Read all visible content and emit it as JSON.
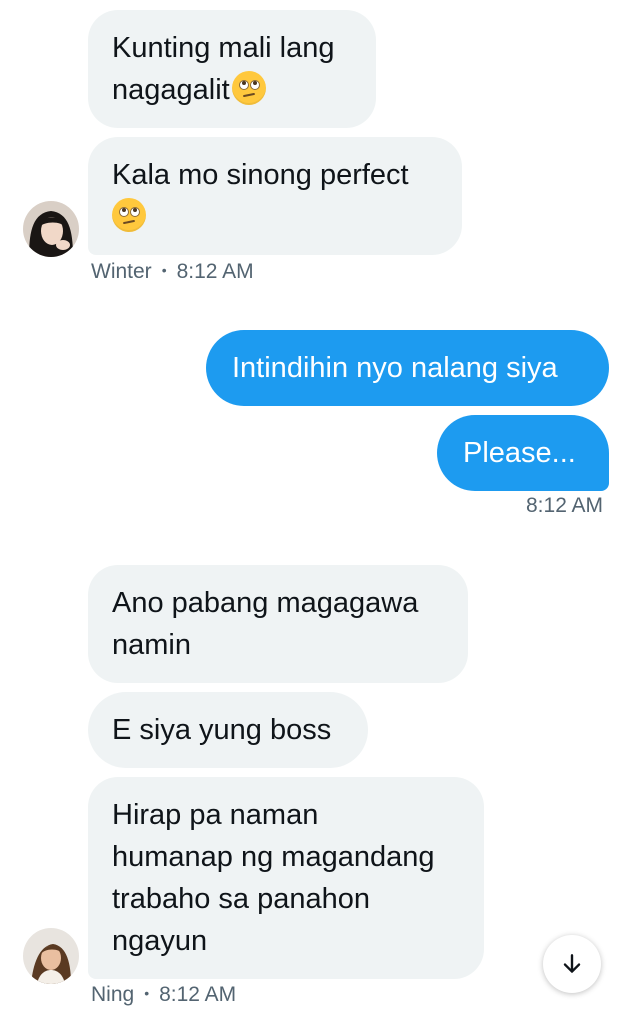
{
  "colors": {
    "incoming_bubble": "#eff3f4",
    "outgoing_bubble": "#1d9bf0",
    "meta_text": "#536471"
  },
  "messages": [
    {
      "group": "winter",
      "lines": [
        "Kunting mali lang",
        "nagagalit"
      ],
      "emoji": "face-with-rolling-eyes"
    },
    {
      "group": "winter",
      "lines": [
        "Kala mo sinong perfect"
      ],
      "emoji": "face-with-rolling-eyes"
    },
    {
      "group": "me",
      "lines": [
        "Intindihin nyo nalang siya"
      ]
    },
    {
      "group": "me",
      "lines": [
        "Please..."
      ]
    },
    {
      "group": "ning",
      "lines": [
        "Ano pabang magagawa",
        "namin"
      ]
    },
    {
      "group": "ning",
      "lines": [
        "E siya yung boss"
      ]
    },
    {
      "group": "ning",
      "lines": [
        "Hirap pa naman",
        "humanap ng magandang",
        "trabaho sa panahon",
        "ngayun"
      ]
    }
  ],
  "meta": {
    "winter": {
      "name": "Winter",
      "time": "8:12 AM"
    },
    "me": {
      "time": "8:12 AM"
    },
    "ning": {
      "name": "Ning",
      "time": "8:12 AM"
    }
  },
  "icons": {
    "scroll_down": "arrow-down-icon"
  }
}
